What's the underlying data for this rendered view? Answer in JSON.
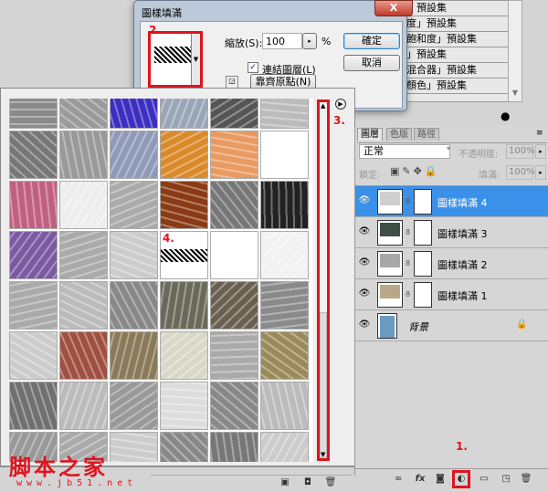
{
  "menu": {
    "items": [
      "」預設集",
      "度」預設集",
      "飽和度」預設集",
      "」預設集",
      "混合器」預設集",
      "顏色」預設集"
    ]
  },
  "dialog": {
    "title": "圖樣填滿",
    "close": "X",
    "scale_label": "縮放(S):",
    "scale_value": "100",
    "percent": "%",
    "ok": "確定",
    "cancel": "取消",
    "link_label": "連結圖層(L)",
    "link_checked": true,
    "snap_origin": "靠齊原點(N)"
  },
  "annotations": {
    "step1": "1.",
    "step2": "2.",
    "step3": "3.",
    "step4": "4.",
    "accent": "#e0141e"
  },
  "patterns": [
    "#8a8a8a",
    "#9a9a9a",
    "#3b2ec0",
    "#9aa6b8",
    "#555555",
    "#bbbbbb",
    "#777777",
    "#999999",
    "#8e9ab8",
    "#d98a2a",
    "#e89a60",
    "#ffffff",
    "#c06080",
    "#eeeeee",
    "#aaaaaa",
    "#8a3a14",
    "#777777",
    "#222222",
    "#7a5aa0",
    "#aaaaaa",
    "#cccccc",
    "#bbbbbb",
    "#ffffff",
    "#f2f2f2",
    "#aaaaaa",
    "#bbbbbb",
    "#888888",
    "#6a6a5a",
    "#6a6050",
    "#8a8a8a",
    "#cccccc",
    "#a05040",
    "#8a7a5a",
    "#d8d8c8",
    "#aaaaaa",
    "#9a8a5a",
    "#707070",
    "#bbbbbb",
    "#999999",
    "#dddddd",
    "#888888",
    "#bbbbbb",
    "#999999",
    "#aaaaaa",
    "#cccccc",
    "#888888",
    "#777777",
    "#cccccc"
  ],
  "layers": {
    "tabs": [
      "圖層",
      "色版",
      "路徑"
    ],
    "blend_mode": "正常",
    "opacity_label": "不透明度:",
    "opacity": "100%",
    "lock_label": "鎖定:",
    "fill_label": "填滿:",
    "fill": "100%",
    "items": [
      {
        "name": "圖樣填滿 4",
        "selected": true,
        "thumb": "#cfcfcf"
      },
      {
        "name": "圖樣填滿 3",
        "selected": false,
        "thumb": "#3d5048"
      },
      {
        "name": "圖樣填滿 2",
        "selected": false,
        "thumb": "#a8a8a8"
      },
      {
        "name": "圖樣填滿 1",
        "selected": false,
        "thumb": "#b8a888"
      },
      {
        "name": "背景",
        "selected": false,
        "thumb": "#6a9ac0"
      }
    ],
    "selected_color": "#3b91ea"
  },
  "watermark": {
    "title": "脚本之家",
    "url": "www.jb51.net"
  }
}
